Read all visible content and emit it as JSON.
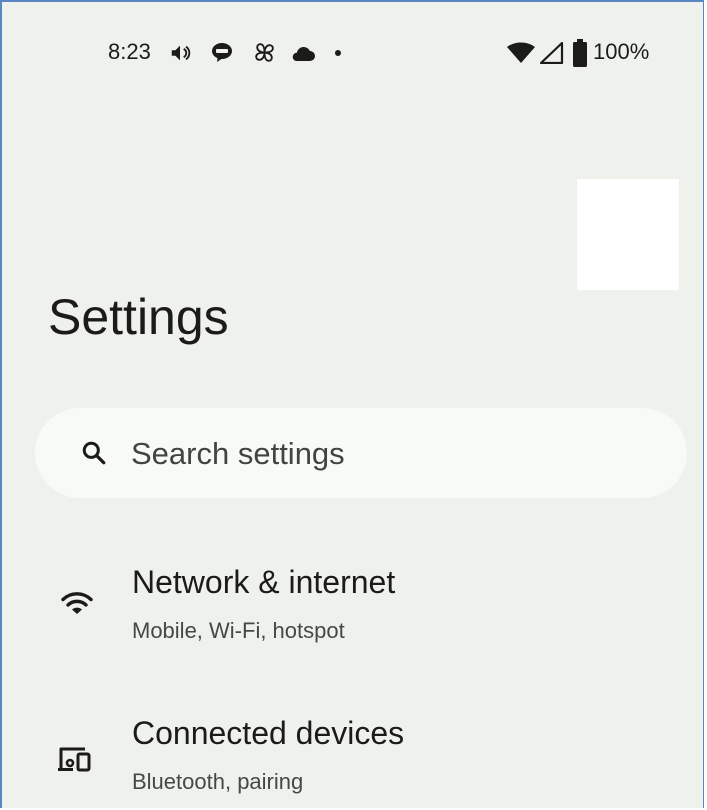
{
  "status_bar": {
    "time": "8:23",
    "battery_percent": "100%",
    "left_icons": [
      "volume-icon",
      "line-app-icon",
      "pinwheel-icon",
      "cloud-icon",
      "dot-icon"
    ],
    "right_icons": [
      "wifi-icon",
      "cellular-signal-icon",
      "battery-icon"
    ]
  },
  "header": {
    "title": "Settings"
  },
  "search": {
    "placeholder": "Search settings",
    "icon": "search-icon"
  },
  "settings_items": [
    {
      "title": "Network & internet",
      "subtitle": "Mobile, Wi-Fi, hotspot",
      "icon": "wifi-icon"
    },
    {
      "title": "Connected devices",
      "subtitle": "Bluetooth, pairing",
      "icon": "connected-devices-icon"
    }
  ],
  "colors": {
    "background": "#eff1ec",
    "search_background": "#f8faf5",
    "text_primary": "#1b1c19",
    "text_secondary": "#454944",
    "frame_border": "#5b86c4"
  }
}
